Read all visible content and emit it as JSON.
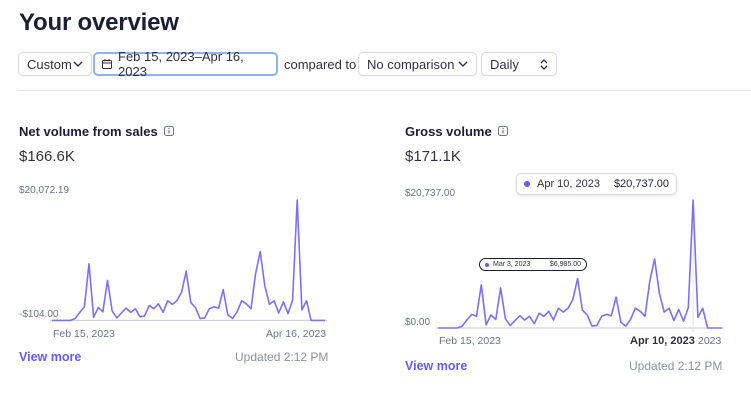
{
  "header": {
    "title": "Your overview"
  },
  "filters": {
    "range_label": "Custom",
    "date_range": "Feb 15, 2023–Apr 16, 2023",
    "compared_to_label": "compared to",
    "comparison": "No comparison",
    "frequency": "Daily"
  },
  "colors": {
    "accent": "#635bff",
    "line": "#7b71f5",
    "axis": "#c4c9d2"
  },
  "cards": [
    {
      "title": "Net volume from sales",
      "value": "$166.6K",
      "ymax_label": "$20,072.19",
      "ymin_label": "-$104.00",
      "x_start_label": "Feb 15, 2023",
      "x_end_label": "Apr 16, 2023",
      "view_more": "View more",
      "updated": "Updated 2:12 PM"
    },
    {
      "title": "Gross volume",
      "value": "$171.1K",
      "ymax_label": "$20,737.00",
      "ymin_label": "$0.00",
      "x_start_label": "Feb 15, 2023",
      "x_hover_label": "Apr 10, 2023",
      "x_end_label": "2023",
      "view_more": "View more",
      "updated": "Updated 2:12 PM",
      "tooltip": {
        "date": "Apr 10, 2023",
        "value": "$20,737.00"
      },
      "tooltip_secondary": {
        "date": "Mar 3, 2023",
        "value": "$6,985.00"
      }
    }
  ],
  "chart_data": [
    {
      "type": "line",
      "title": "Net volume from sales",
      "x_range": [
        "Feb 15, 2023",
        "Apr 16, 2023"
      ],
      "ylim": [
        -104.0,
        20072.19
      ],
      "series": [
        {
          "values": [
            0,
            0,
            0,
            0,
            0,
            300,
            1300,
            2200,
            9200,
            500,
            2100,
            1400,
            6500,
            1500,
            400,
            1200,
            2000,
            1300,
            1900,
            600,
            700,
            2400,
            1900,
            2700,
            1300,
            3200,
            2600,
            3200,
            4600,
            8000,
            2900,
            2100,
            300,
            400,
            1900,
            2200,
            2000,
            5000,
            900,
            300,
            1400,
            3200,
            2700,
            1900,
            7600,
            11200,
            5600,
            2600,
            3200,
            1200,
            3000,
            1100,
            3300,
            19600,
            1700,
            3200,
            0,
            0,
            0,
            0
          ]
        }
      ]
    },
    {
      "type": "line",
      "title": "Gross volume",
      "x_range": [
        "Feb 15, 2023",
        "Apr 16, 2023"
      ],
      "ylim": [
        0,
        20737.0
      ],
      "series": [
        {
          "values": [
            0,
            0,
            0,
            0,
            0,
            300,
            1300,
            2200,
            1900,
            6985,
            500,
            2100,
            1400,
            6500,
            1500,
            400,
            1200,
            2000,
            1300,
            1900,
            700,
            2400,
            1900,
            2700,
            1300,
            3200,
            2600,
            3200,
            4600,
            8000,
            2900,
            2100,
            300,
            400,
            1900,
            2200,
            2000,
            5000,
            900,
            300,
            1400,
            3200,
            2700,
            1900,
            7600,
            11200,
            5600,
            2600,
            3200,
            1200,
            3000,
            1100,
            3300,
            20737,
            1700,
            3200,
            0,
            0,
            0,
            0
          ]
        }
      ]
    }
  ]
}
